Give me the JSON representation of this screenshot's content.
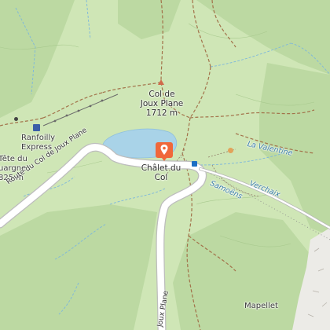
{
  "labels": {
    "col_name_line1": "Col de",
    "col_name_line2": "Joux Plane",
    "col_elevation": "1712 m",
    "chalet_line1": "Châlet du",
    "chalet_line2": "Col",
    "ranfoilly_line1": "Ranfoilly",
    "ranfoilly_line2": "Express",
    "tete_line1": "Tête du",
    "tete_line2": "uargne",
    "tete_line3": "825 m",
    "route_col": "Route du Col de Joux Plane",
    "route_joux": "Joux Plane",
    "valentine": "La Valentine",
    "samoens": "Samoëns",
    "verchaix": "Verchaix",
    "mapellet": "Mapellet"
  },
  "colors": {
    "meadow": "#cfe6b6",
    "forest": "#b9d79f",
    "lake": "#a9d3e8",
    "road": "#ffffff",
    "road_casing": "#b9b9b9",
    "trail": "#a2724a",
    "stream": "#7cb7dc",
    "marker": "#f0683a",
    "rock": "#f1efec"
  },
  "marker": {
    "icon": "map-pin-icon"
  },
  "icons": [
    "bus-stop-icon",
    "cable-car-icon",
    "parking-icon",
    "map-pin-icon"
  ]
}
